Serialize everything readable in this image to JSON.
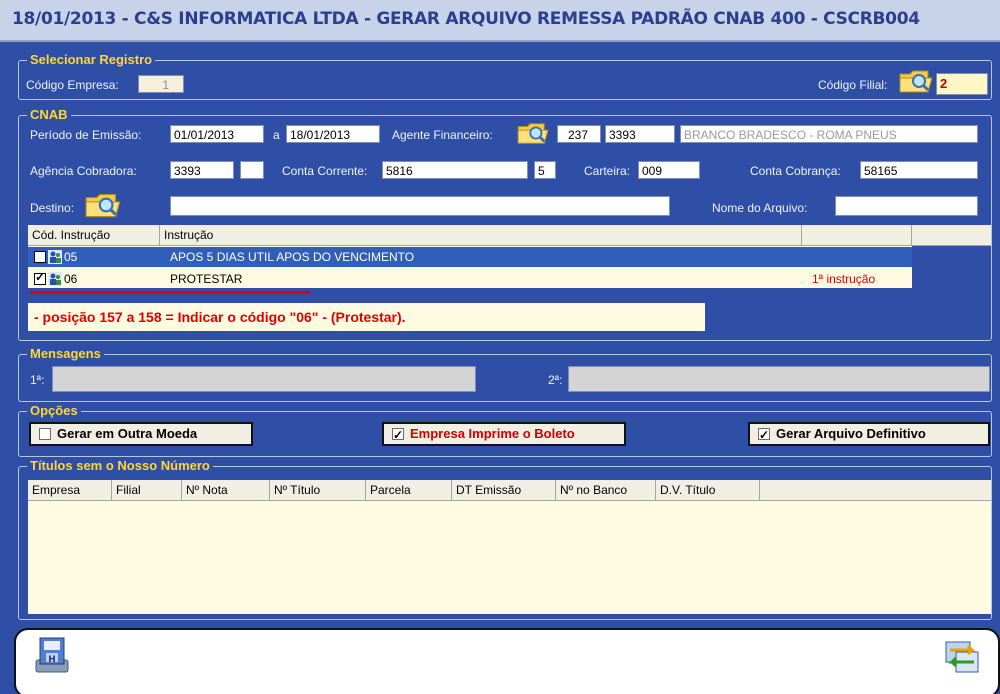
{
  "window": {
    "title": "18/01/2013  -  C&S INFORMATICA LTDA  -  GERAR ARQUIVO REMESSA PADRÃO CNAB 400  -  CSCRB004"
  },
  "selecionar": {
    "legend": "Selecionar Registro",
    "codigo_empresa_label": "Código Empresa:",
    "codigo_empresa": "1",
    "codigo_filial_label": "Código Filial:",
    "codigo_filial": "2"
  },
  "cnab": {
    "legend": "CNAB",
    "periodo_label": "Período de Emissão:",
    "periodo_inicio": "01/01/2013",
    "a_label": "a",
    "periodo_fim": "18/01/2013",
    "agente_label": "Agente Financeiro:",
    "agente_codigo": "237",
    "agente_agencia": "3393",
    "agente_nome": "BRANCO BRADESCO - ROMA PNEUS",
    "agencia_label": "Agência Cobradora:",
    "agencia": "3393",
    "agencia_dv": "",
    "conta_label": "Conta Corrente:",
    "conta": "5816",
    "conta_dv": "5",
    "carteira_label": "Carteira:",
    "carteira": "009",
    "conta_cobranca_label": "Conta Cobrança:",
    "conta_cobranca": "58165",
    "destino_label": "Destino:",
    "destino": "",
    "nome_arquivo_label": "Nome do Arquivo:",
    "nome_arquivo": ""
  },
  "instrucoes": {
    "headers": [
      "Cód. Instrução",
      "Instrução",
      "",
      ""
    ],
    "rows": [
      {
        "codigo": "05",
        "instrucao": "APOS 5 DIAS UTIL APOS DO VENCIMENTO",
        "checked": false,
        "selected": true,
        "nota": ""
      },
      {
        "codigo": "06",
        "instrucao": "PROTESTAR",
        "checked": true,
        "selected": false,
        "nota": "1ª instrução"
      }
    ],
    "annotation": "- posição 157 a 158 = Indicar o código \"06\" - (Protestar)."
  },
  "mensagens": {
    "legend": "Mensagens",
    "msg1_label": "1ª:",
    "msg1": "",
    "msg2_label": "2ª:",
    "msg2": ""
  },
  "opcoes": {
    "legend": "Opções",
    "outra_moeda": {
      "label": "Gerar em Outra Moeda",
      "checked": false
    },
    "imprime_boleto": {
      "label": "Empresa Imprime o Boleto",
      "checked": true
    },
    "definitivo": {
      "label": "Gerar  Arquivo Definitivo",
      "checked": true
    }
  },
  "titulos": {
    "legend": "Títulos sem o Nosso Número",
    "headers": [
      "Empresa",
      "Filial",
      "Nº Nota",
      "Nº Título",
      "Parcela",
      "DT Emissão",
      "Nº no Banco",
      "D.V. Título"
    ]
  },
  "colors": {
    "window_bg": "#2e4fa5",
    "legend": "#ffd633",
    "highlight": "#2f5fb8",
    "annotation_red": "#e00000"
  }
}
